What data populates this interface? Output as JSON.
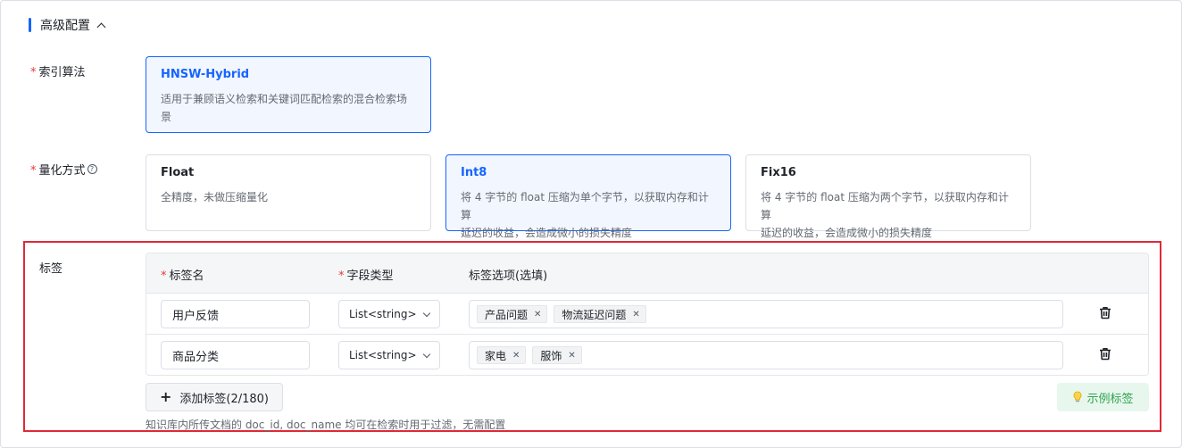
{
  "section": {
    "title": "高级配置"
  },
  "index_algorithm": {
    "label": "索引算法",
    "options": [
      {
        "title": "HNSW-Hybrid",
        "desc_line1": "适用于兼顾语义检索和关键词匹配检索的混合检索场",
        "desc_line2": "景",
        "selected": true
      }
    ]
  },
  "quantization": {
    "label": "量化方式",
    "options": [
      {
        "title": "Float",
        "desc_line1": "全精度，未做压缩量化",
        "desc_line2": "",
        "selected": false
      },
      {
        "title": "Int8",
        "desc_line1": "将 4 字节的 float 压缩为单个字节，以获取内存和计算",
        "desc_line2": "延迟的收益，会造成微小的损失精度",
        "selected": true
      },
      {
        "title": "Fix16",
        "desc_line1": "将 4 字节的 float 压缩为两个字节，以获取内存和计算",
        "desc_line2": "延迟的收益，会造成微小的损失精度",
        "selected": false
      }
    ]
  },
  "tags": {
    "label": "标签",
    "columns": {
      "name": "标签名",
      "type": "字段类型",
      "options": "标签选项(选填)"
    },
    "rows": [
      {
        "name": "用户反馈",
        "type": "List<string>",
        "chips": [
          "产品问题",
          "物流延迟问题"
        ]
      },
      {
        "name": "商品分类",
        "type": "List<string>",
        "chips": [
          "家电",
          "服饰"
        ]
      }
    ],
    "add_button": "添加标签(2/180)",
    "example_button": "示例标签",
    "hint": "知识库内所传文档的 doc_id, doc_name 均可在检索时用于过滤，无需配置"
  },
  "colors": {
    "accent": "#1664ff",
    "required": "#e63a3a",
    "highlight_border": "#e0293a",
    "example_green": "#2fa34f"
  }
}
